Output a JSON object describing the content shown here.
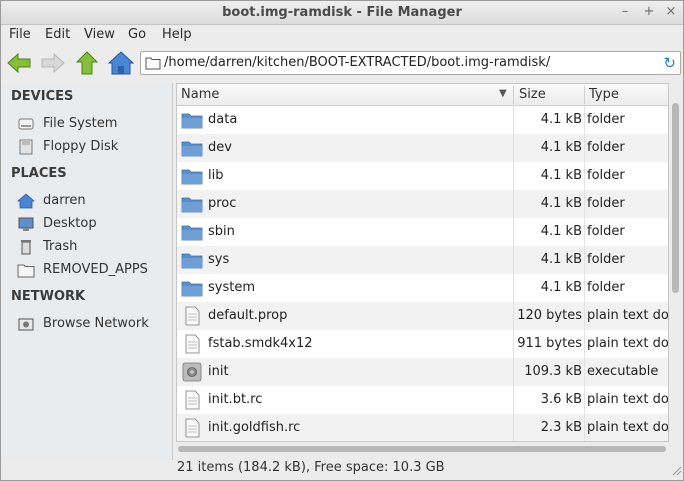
{
  "window": {
    "title": "boot.img-ramdisk - File Manager",
    "controls": {
      "minimize": "–",
      "maximize": "+",
      "close": "×"
    }
  },
  "menubar": [
    "File",
    "Edit",
    "View",
    "Go",
    "Help"
  ],
  "toolbar": {
    "back_icon": "back-arrow-icon",
    "forward_icon": "forward-arrow-icon",
    "up_icon": "up-arrow-icon",
    "home_icon": "home-icon",
    "location": "/home/darren/kitchen/BOOT-EXTRACTED/boot.img-ramdisk/",
    "reload_icon": "↻"
  },
  "sidebar": {
    "sections": [
      {
        "title": "DEVICES",
        "items": [
          {
            "label": "File System",
            "icon": "drive-icon"
          },
          {
            "label": "Floppy Disk",
            "icon": "floppy-icon"
          }
        ]
      },
      {
        "title": "PLACES",
        "items": [
          {
            "label": "darren",
            "icon": "home-icon"
          },
          {
            "label": "Desktop",
            "icon": "desktop-icon"
          },
          {
            "label": "Trash",
            "icon": "trash-icon"
          },
          {
            "label": "REMOVED_APPS",
            "icon": "folder-icon"
          }
        ]
      },
      {
        "title": "NETWORK",
        "items": [
          {
            "label": "Browse Network",
            "icon": "network-icon"
          }
        ]
      }
    ]
  },
  "columns": {
    "name": "Name",
    "size": "Size",
    "type": "Type"
  },
  "files": [
    {
      "name": "data",
      "size": "4.1 kB",
      "type": "folder",
      "kind": "folder"
    },
    {
      "name": "dev",
      "size": "4.1 kB",
      "type": "folder",
      "kind": "folder"
    },
    {
      "name": "lib",
      "size": "4.1 kB",
      "type": "folder",
      "kind": "folder"
    },
    {
      "name": "proc",
      "size": "4.1 kB",
      "type": "folder",
      "kind": "folder"
    },
    {
      "name": "sbin",
      "size": "4.1 kB",
      "type": "folder",
      "kind": "folder"
    },
    {
      "name": "sys",
      "size": "4.1 kB",
      "type": "folder",
      "kind": "folder"
    },
    {
      "name": "system",
      "size": "4.1 kB",
      "type": "folder",
      "kind": "folder"
    },
    {
      "name": "default.prop",
      "size": "120 bytes",
      "type": "plain text doc",
      "kind": "text"
    },
    {
      "name": "fstab.smdk4x12",
      "size": "911 bytes",
      "type": "plain text doc",
      "kind": "text"
    },
    {
      "name": "init",
      "size": "109.3 kB",
      "type": "executable",
      "kind": "exec"
    },
    {
      "name": "init.bt.rc",
      "size": "3.6 kB",
      "type": "plain text doc",
      "kind": "text"
    },
    {
      "name": "init.goldfish.rc",
      "size": "2.3 kB",
      "type": "plain text doc",
      "kind": "text"
    }
  ],
  "status": "21 items (184.2 kB), Free space: 10.3 GB",
  "colors": {
    "folder": "#5b8fc9",
    "arrow_green": "#7cb82f",
    "home_blue": "#3f7fd0"
  }
}
